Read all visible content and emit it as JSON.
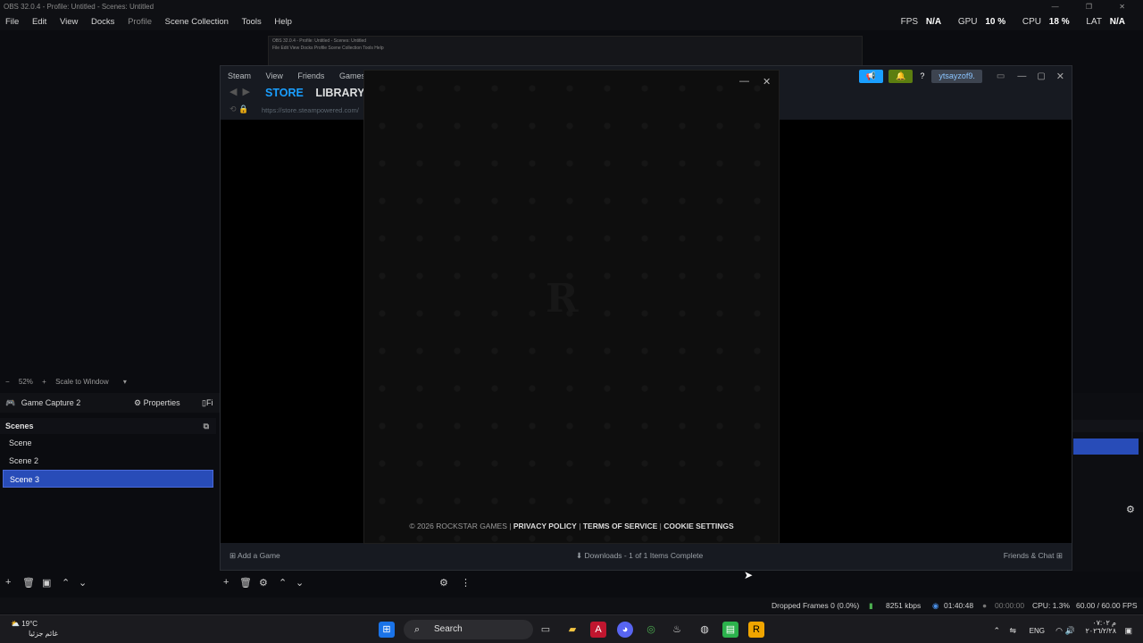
{
  "window": {
    "title": "OBS 32.0.4 - Profile: Untitled - Scenes: Untitled",
    "controls": [
      "—",
      "❐",
      "✕"
    ]
  },
  "menu": [
    "File",
    "Edit",
    "View",
    "Docks",
    "Profile",
    "Scene Collection",
    "Tools",
    "Help"
  ],
  "stats": [
    {
      "label": "FPS",
      "value": "N/A"
    },
    {
      "label": "GPU",
      "value": "10 %"
    },
    {
      "label": "CPU",
      "value": "18 %"
    },
    {
      "label": "LAT",
      "value": "N/A"
    }
  ],
  "nested_capture": {
    "line1": "OBS 32.0.4 - Profile: Untitled - Scenes: Untitled",
    "line2": "File Edit View Docks Profile Scene Collection Tools Help"
  },
  "steam": {
    "menu": [
      "Steam",
      "View",
      "Friends",
      "Games",
      "H"
    ],
    "tab_store": "STORE",
    "tab_library": "LIBRARY",
    "url": "https://store.steampowered.com/",
    "username": "ytsayzof9.",
    "help": "?",
    "add_game": "Add a Game",
    "downloads": "Downloads - 1 of 1 Items Complete",
    "friends_chat": "Friends & Chat"
  },
  "rockstar": {
    "logo": "R",
    "copyright": "© 2026 ROCKSTAR GAMES |",
    "privacy": "PRIVACY POLICY",
    "sep1": "|",
    "tos": "TERMS OF SERVICE",
    "sep2": "|",
    "cookies": "COOKIE SETTINGS"
  },
  "zoom": {
    "minus": "−",
    "level": "52%",
    "plus": "+",
    "mode": "Scale to Window"
  },
  "source": {
    "name": "Game Capture 2",
    "properties": "Properties",
    "filters": "Fi"
  },
  "scenes": {
    "header": "Scenes",
    "items": [
      "Scene",
      "Scene 2",
      "Scene 3"
    ],
    "selected_index": 2
  },
  "status": {
    "dropped": "Dropped Frames 0 (0.0%)",
    "bitrate": "8251 kbps",
    "stream_time": "01:40:48",
    "rec_time": "00:00:00",
    "cpu": "CPU: 1.3%",
    "fps": "60.00 / 60.00 FPS"
  },
  "taskbar": {
    "weather_temp": "19°C",
    "weather_desc": "غائم جزئيا",
    "search": "Search",
    "lang": "ENG",
    "time": "۰۷:۰۲ م",
    "date": "۲۰۲٦/۲/۲۸"
  }
}
